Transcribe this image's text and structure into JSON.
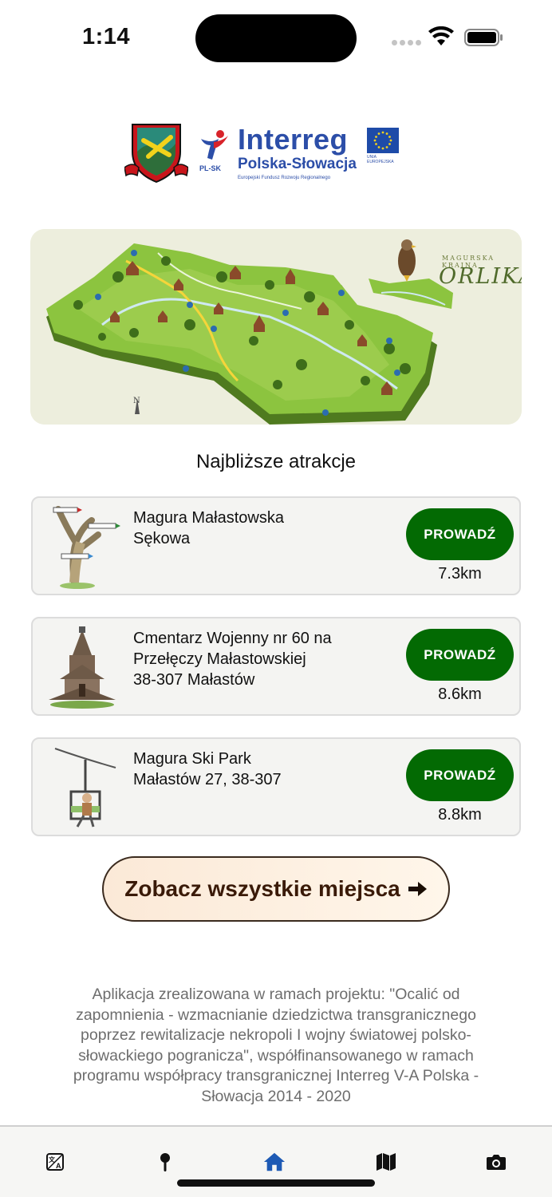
{
  "status_bar": {
    "time": "1:14"
  },
  "logos": {
    "interreg_title": "Interreg",
    "interreg_subtitle": "Polska-Słowacja",
    "interreg_small": "Europejski Fundusz Rozwoju Regionalnego",
    "plsk_label": "PL-SK",
    "eu_label": "UNIA EUROPEJSKA"
  },
  "map_banner": {
    "brand_small": "MAGURSKA  KRAINA",
    "brand_big": "ORLIKA"
  },
  "section_title": "Najbliższe atrakcje",
  "attractions": [
    {
      "lines": [
        "Magura Małastowska",
        "Sękowa"
      ],
      "button": "PROWADŹ",
      "distance": "7.3km"
    },
    {
      "lines": [
        "Cmentarz Wojenny nr 60 na",
        "Przełęczy Małastowskiej",
        "38-307 Małastów"
      ],
      "button": "PROWADŹ",
      "distance": "8.6km"
    },
    {
      "lines": [
        "Magura Ski Park",
        "Małastów 27, 38-307"
      ],
      "button": "PROWADŹ",
      "distance": "8.8km"
    }
  ],
  "see_all_label": "Zobacz wszystkie miejsca",
  "footer_lines": [
    "Aplikacja zrealizowana w ramach projektu: \"Ocalić od",
    "zapomnienia - wzmacnianie dziedzictwa transgranicznego",
    "poprzez rewitalizacje nekropoli I wojny światowej polsko-",
    "słowackiego pogranicza\", współfinansowanego w ramach",
    "programu współpracy transgranicznej Interreg V-A Polska -",
    "Słowacja 2014 - 2020"
  ],
  "tab_bar": {
    "tabs": [
      "translate-icon",
      "pin-icon",
      "home-icon",
      "map-icon",
      "camera-icon"
    ],
    "active": "home-icon",
    "active_color": "#1e5ab4"
  },
  "colors": {
    "primary_button": "#036a03",
    "brand_blue": "#2c4ea8"
  }
}
